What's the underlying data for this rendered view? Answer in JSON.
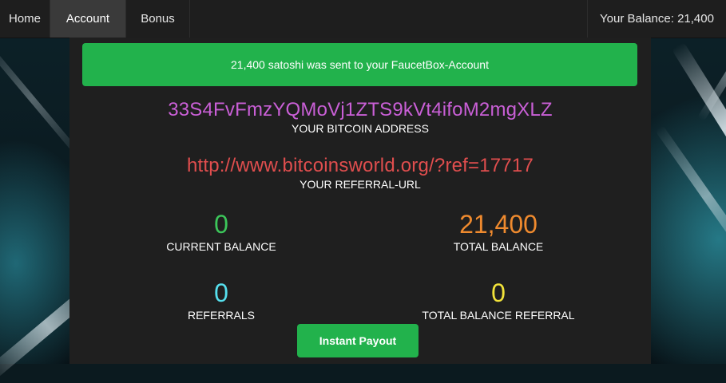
{
  "nav": {
    "home": "Home",
    "account": "Account",
    "bonus": "Bonus",
    "balance": "Your Balance: 21,400"
  },
  "alert": {
    "message": "21,400 satoshi was sent to your FaucetBox-Account"
  },
  "address": {
    "value": "33S4FvFmzYQMoVj1ZTS9kVt4ifoM2mgXLZ",
    "caption": "YOUR BITCOIN ADDRESS"
  },
  "referral_url": {
    "value": "http://www.bitcoinsworld.org/?ref=17717",
    "caption": "YOUR REFERRAL-URL"
  },
  "stats": {
    "current_balance": {
      "value": "0",
      "label": "CURRENT BALANCE",
      "color": "#3cc65a"
    },
    "total_balance": {
      "value": "21,400",
      "label": "TOTAL BALANCE",
      "color": "#ef8a2e"
    },
    "referrals": {
      "value": "0",
      "label": "REFERRALS",
      "color": "#56e0ee"
    },
    "total_balance_referral": {
      "value": "0",
      "label": "TOTAL BALANCE REFERRAL",
      "color": "#f2e33a"
    }
  },
  "payout_button": "Instant Payout",
  "colors": {
    "accent_green": "#22b24c",
    "address_purple": "#c95fd6",
    "referral_red": "#e04e4e"
  }
}
